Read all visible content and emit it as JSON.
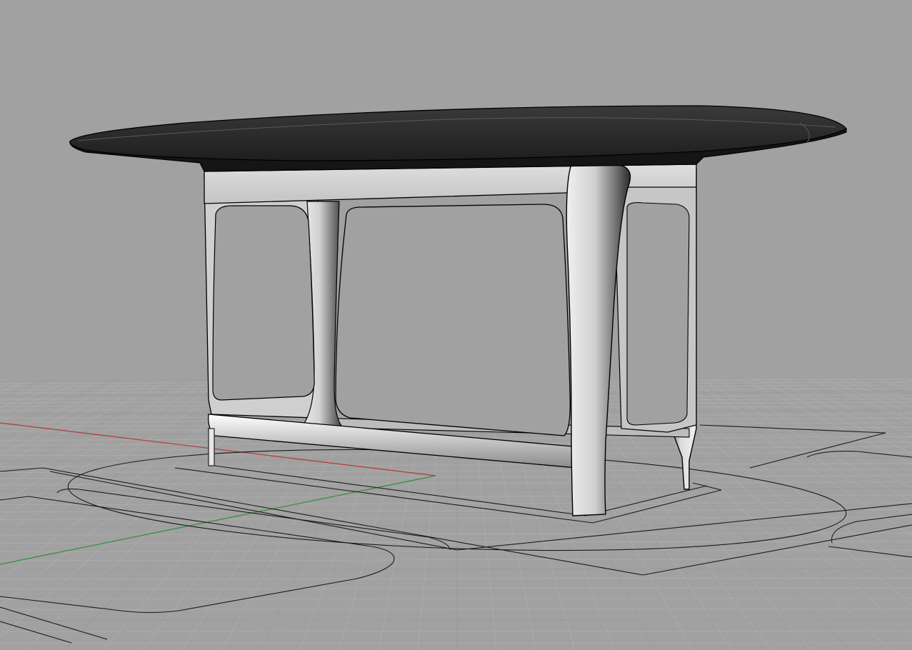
{
  "viewport": {
    "label": "",
    "view": "perspective",
    "display_mode": "shaded",
    "background_color": "#a1a1a1",
    "grid": {
      "visible": true,
      "minor_color": "#b1b1b1",
      "major_color": "#9a9a9a"
    },
    "axes": {
      "x_axis_color": "#b23a3a",
      "y_axis_color": "#2f8f3a"
    },
    "object": {
      "name": "table-model",
      "top_color": "#2b2b2b",
      "frame_color": "#d3d3d3",
      "edge_color": "#000000"
    }
  }
}
